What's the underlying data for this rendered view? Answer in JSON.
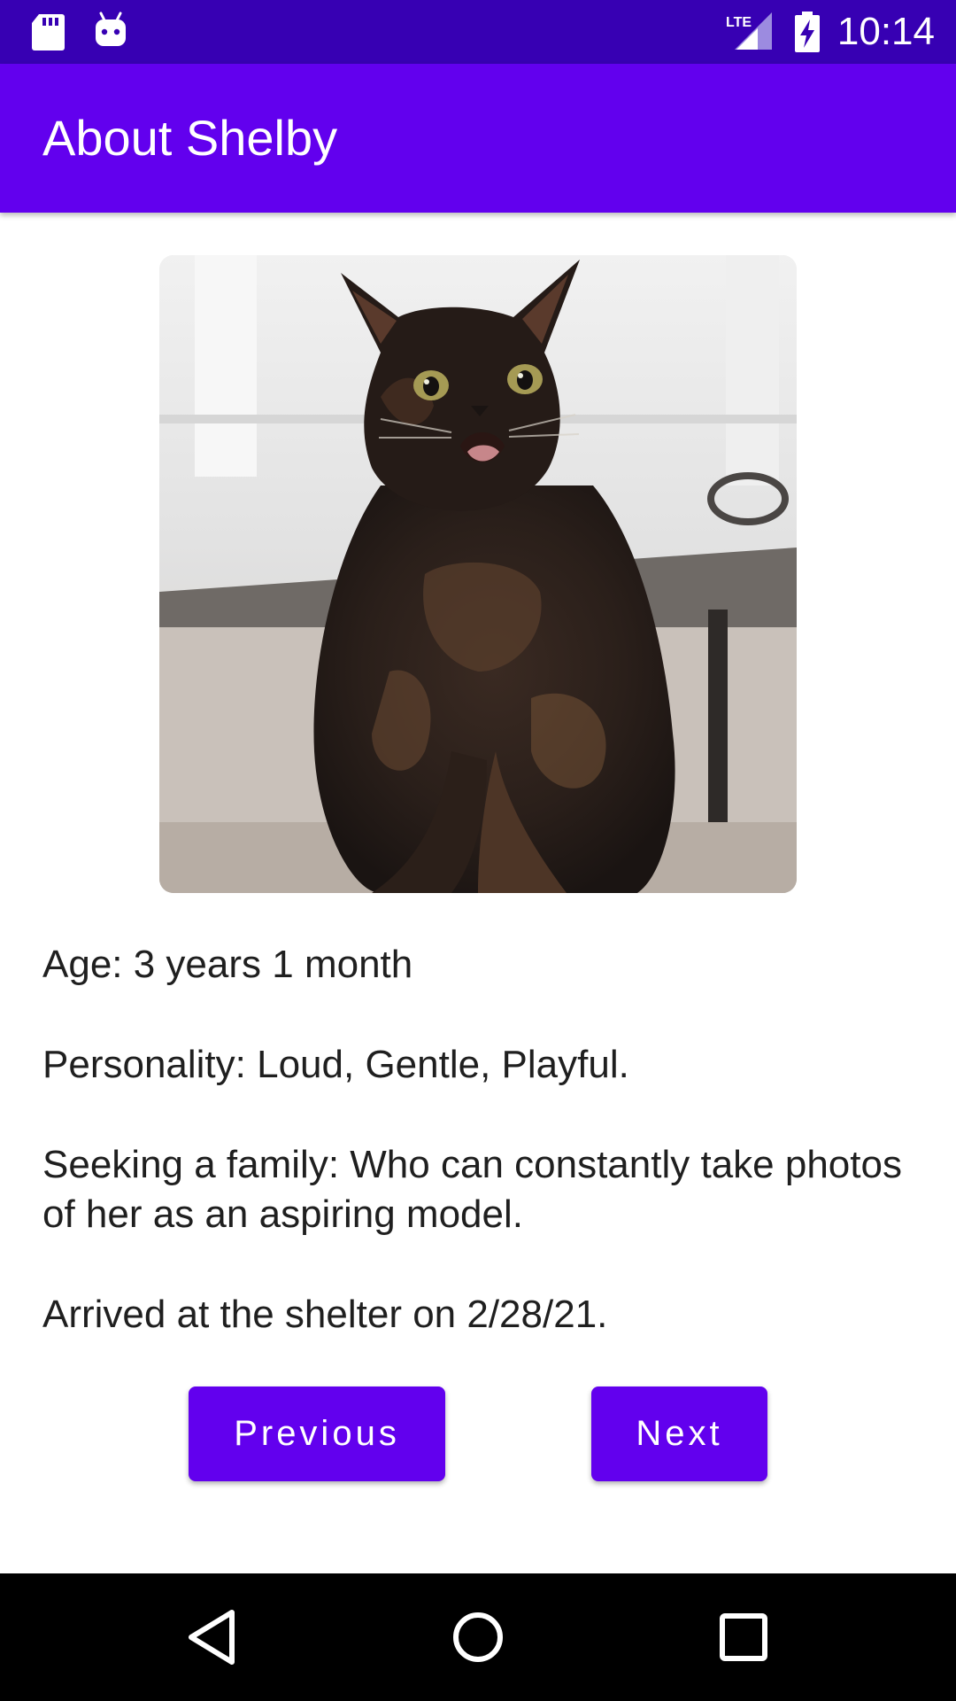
{
  "status_bar": {
    "time": "10:14",
    "icons": [
      "sd-card-icon",
      "android-debug-icon",
      "lte-signal-icon",
      "battery-charging-icon"
    ]
  },
  "app_bar": {
    "title": "About Shelby"
  },
  "pet": {
    "photo_icon": "cat-photo",
    "age": "Age: 3 years 1 month",
    "personality": "Personality: Loud, Gentle, Playful.",
    "seeking": "Seeking a family: Who can constantly take photos of her as an aspiring model.",
    "arrived": "Arrived at the shelter on 2/28/21."
  },
  "buttons": {
    "previous": "Previous",
    "next": "Next"
  },
  "nav_bar": {
    "icons": [
      "back-icon",
      "home-icon",
      "recents-icon"
    ]
  },
  "colors": {
    "status_bar": "#3700b3",
    "primary": "#6200ee",
    "text": "#1f1f1f"
  }
}
